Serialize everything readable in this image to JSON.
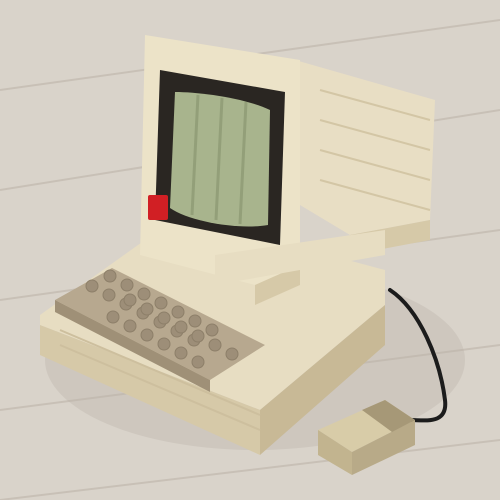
{
  "image": {
    "subject": "lego-retro-computer",
    "colors": {
      "floor_light": "#dcd6cd",
      "floor_mid": "#cfc8be",
      "floor_grain": "#b8b0a5",
      "case_light": "#ece3c8",
      "case_mid": "#ddd1b1",
      "case_shadow": "#c2b48f",
      "screen_frame": "#2a2622",
      "screen_green": "#a8b48d",
      "screen_green_shadow": "#8e9b75",
      "key_dark": "#9d8e78",
      "key_light": "#b8aa92",
      "power_red": "#d11f24",
      "cable": "#1c1c1c",
      "mouse_top": "#d8cca8",
      "mouse_button": "#a69877"
    }
  }
}
